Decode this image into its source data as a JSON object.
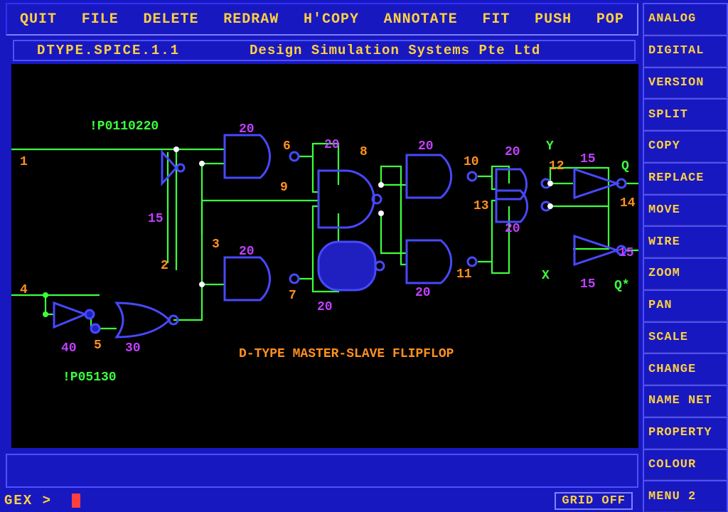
{
  "topmenu": [
    "QUIT",
    "FILE",
    "DELETE",
    "REDRAW",
    "H'COPY",
    "ANNOTATE",
    "FIT",
    "PUSH",
    "POP"
  ],
  "sidemenu": [
    "ANALOG",
    "DIGITAL",
    "VERSION",
    "SPLIT",
    "COPY",
    "REPLACE",
    "MOVE",
    "WIRE",
    "ZOOM",
    "PAN",
    "SCALE",
    "CHANGE",
    "NAME NET",
    "PROPERTY",
    "COLOUR",
    "MENU 2"
  ],
  "title": {
    "file": "DTYPE.SPICE.1.1",
    "company": "Design Simulation Systems Pte Ltd"
  },
  "cmd": {
    "prompt": "GEX >",
    "grid": "GRID OFF"
  },
  "schematic": {
    "caption": "D-TYPE MASTER-SLAVE FLIPFLOP",
    "net_labels": [
      "!P0110220",
      "!P05130"
    ],
    "pin_numbers_orange": [
      "1",
      "2",
      "3",
      "4",
      "5",
      "6",
      "7",
      "8",
      "9",
      "10",
      "11",
      "12",
      "13",
      "14"
    ],
    "fanouts_purple": [
      "15",
      "15",
      "15",
      "15",
      "20",
      "20",
      "20",
      "20",
      "20",
      "20",
      "20",
      "20",
      "30",
      "40"
    ],
    "signals_green": [
      "X",
      "Y",
      "Q",
      "Q*"
    ]
  }
}
